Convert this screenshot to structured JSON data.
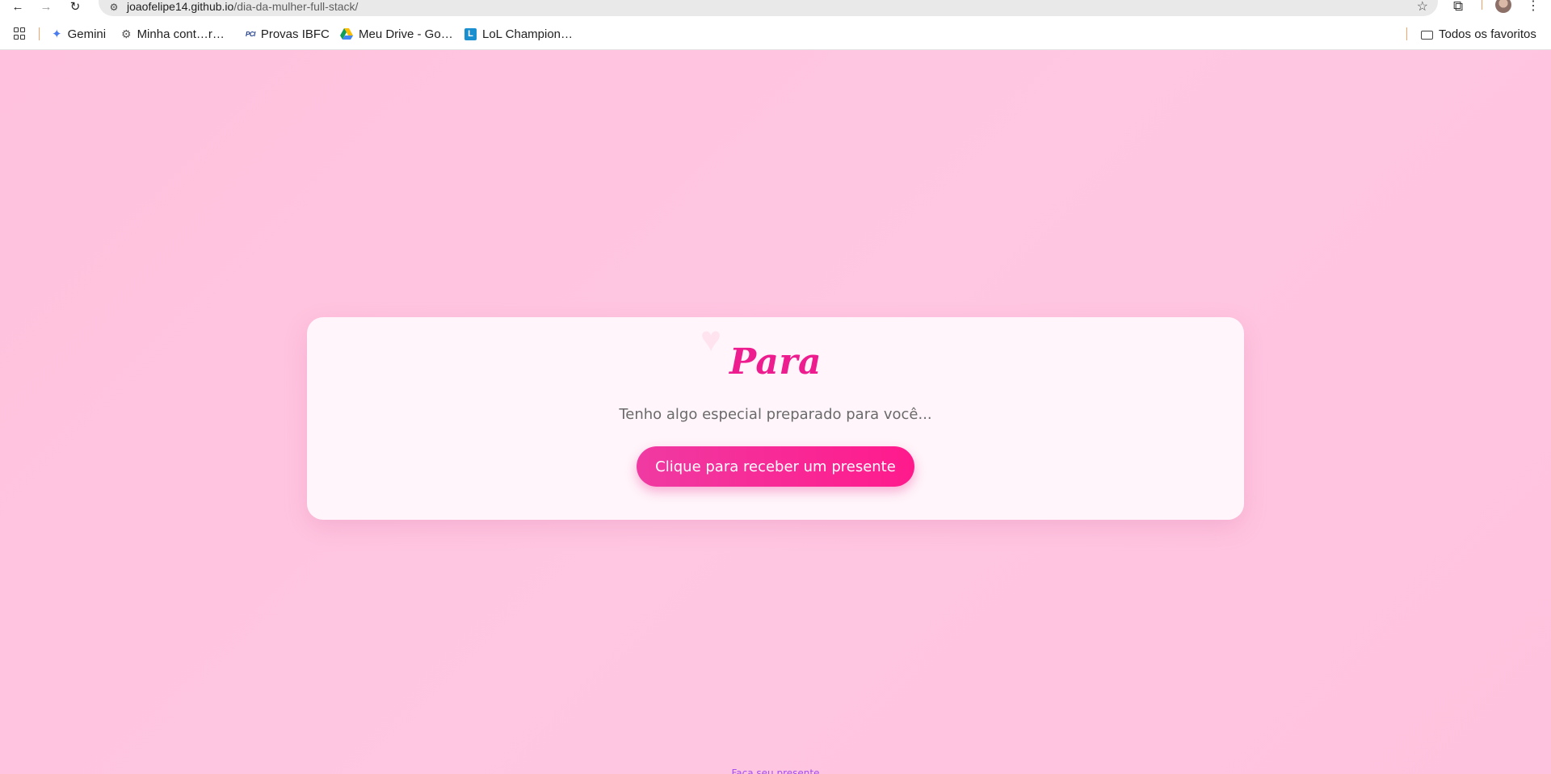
{
  "browser": {
    "url_host": "joaofelipe14.github.io",
    "url_path": "/dia-da-mulher-full-stack/",
    "nav": {
      "back_icon": "←",
      "forward_icon": "→",
      "reload_icon": "↻"
    },
    "star_icon": "☆",
    "extensions_icon": "⧉",
    "menu_icon": "⋮",
    "site_info_icon": "⚙"
  },
  "bookmarks": {
    "items": [
      {
        "label": "Gemini",
        "icon": "gemini-icon",
        "glyph": "✦"
      },
      {
        "label": "Minha cont…r…",
        "icon": "gear-icon",
        "glyph": "⚙"
      },
      {
        "label": "Provas IBFC",
        "icon": "pci-icon",
        "glyph": "PCI"
      },
      {
        "label": "Meu Drive - Go…",
        "icon": "google-drive-icon",
        "glyph": ""
      },
      {
        "label": "LoL Champion…",
        "icon": "lol-icon",
        "glyph": "L"
      }
    ],
    "all_bookmarks_label": "Todos os favoritos"
  },
  "card": {
    "title": "Para",
    "subtitle": "Tenho algo especial preparado para você...",
    "button_label": "Clique para receber um presente"
  },
  "footer": {
    "link_label": "Faça seu presente"
  },
  "colors": {
    "page_background": "#ffc4e0",
    "accent": "#ee1d8f",
    "button_start": "#f03aa2",
    "button_end": "#ff1a8c",
    "footer_link": "#a44ef0"
  }
}
